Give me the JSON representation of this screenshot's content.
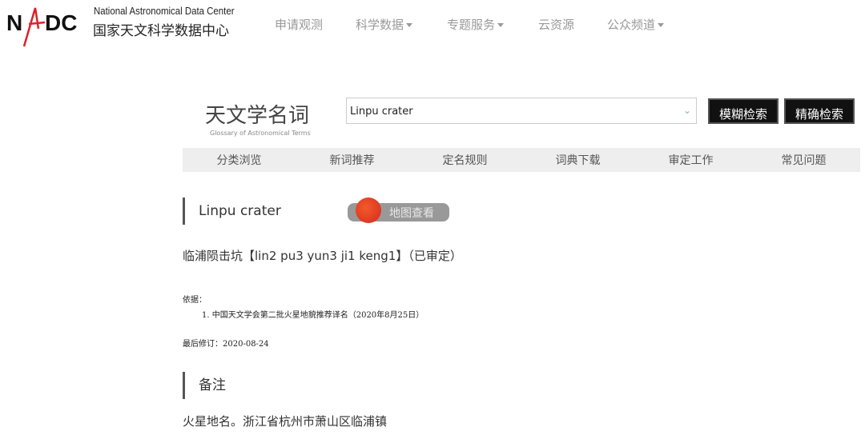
{
  "header": {
    "logo_text": "NADC",
    "org_en": "National Astronomical Data Center",
    "org_cn": "国家天文科学数据中心",
    "nav": [
      {
        "label": "申请观测",
        "dropdown": false
      },
      {
        "label": "科学数据",
        "dropdown": true
      },
      {
        "label": "专题服务",
        "dropdown": true
      },
      {
        "label": "云资源",
        "dropdown": false
      },
      {
        "label": "公众频道",
        "dropdown": true
      }
    ]
  },
  "site": {
    "title": "天文学名词",
    "subtitle": "Glossary of Astronomical Terms"
  },
  "search": {
    "value": "Linpu crater",
    "fuzzy_label": "模糊检索",
    "exact_label": "精确检索"
  },
  "menu": [
    "分类浏览",
    "新词推荐",
    "定名规则",
    "词典下载",
    "审定工作",
    "常见问题"
  ],
  "term": {
    "name": "Linpu crater",
    "map_label": "地图查看",
    "cn": "临浦陨击坑【",
    "pinyin": "lin2 pu3 yun3 ji1 keng1",
    "close": "】（已审定）",
    "basis_label": "依据：",
    "basis": [
      "1.  中国天文学会第二批火星地貌推荐译名（2020年8月25日）"
    ],
    "revised": "最后修订：2020-08-24"
  },
  "notes": {
    "heading": "备注",
    "text": "火星地名。浙江省杭州市萧山区临浦镇"
  }
}
